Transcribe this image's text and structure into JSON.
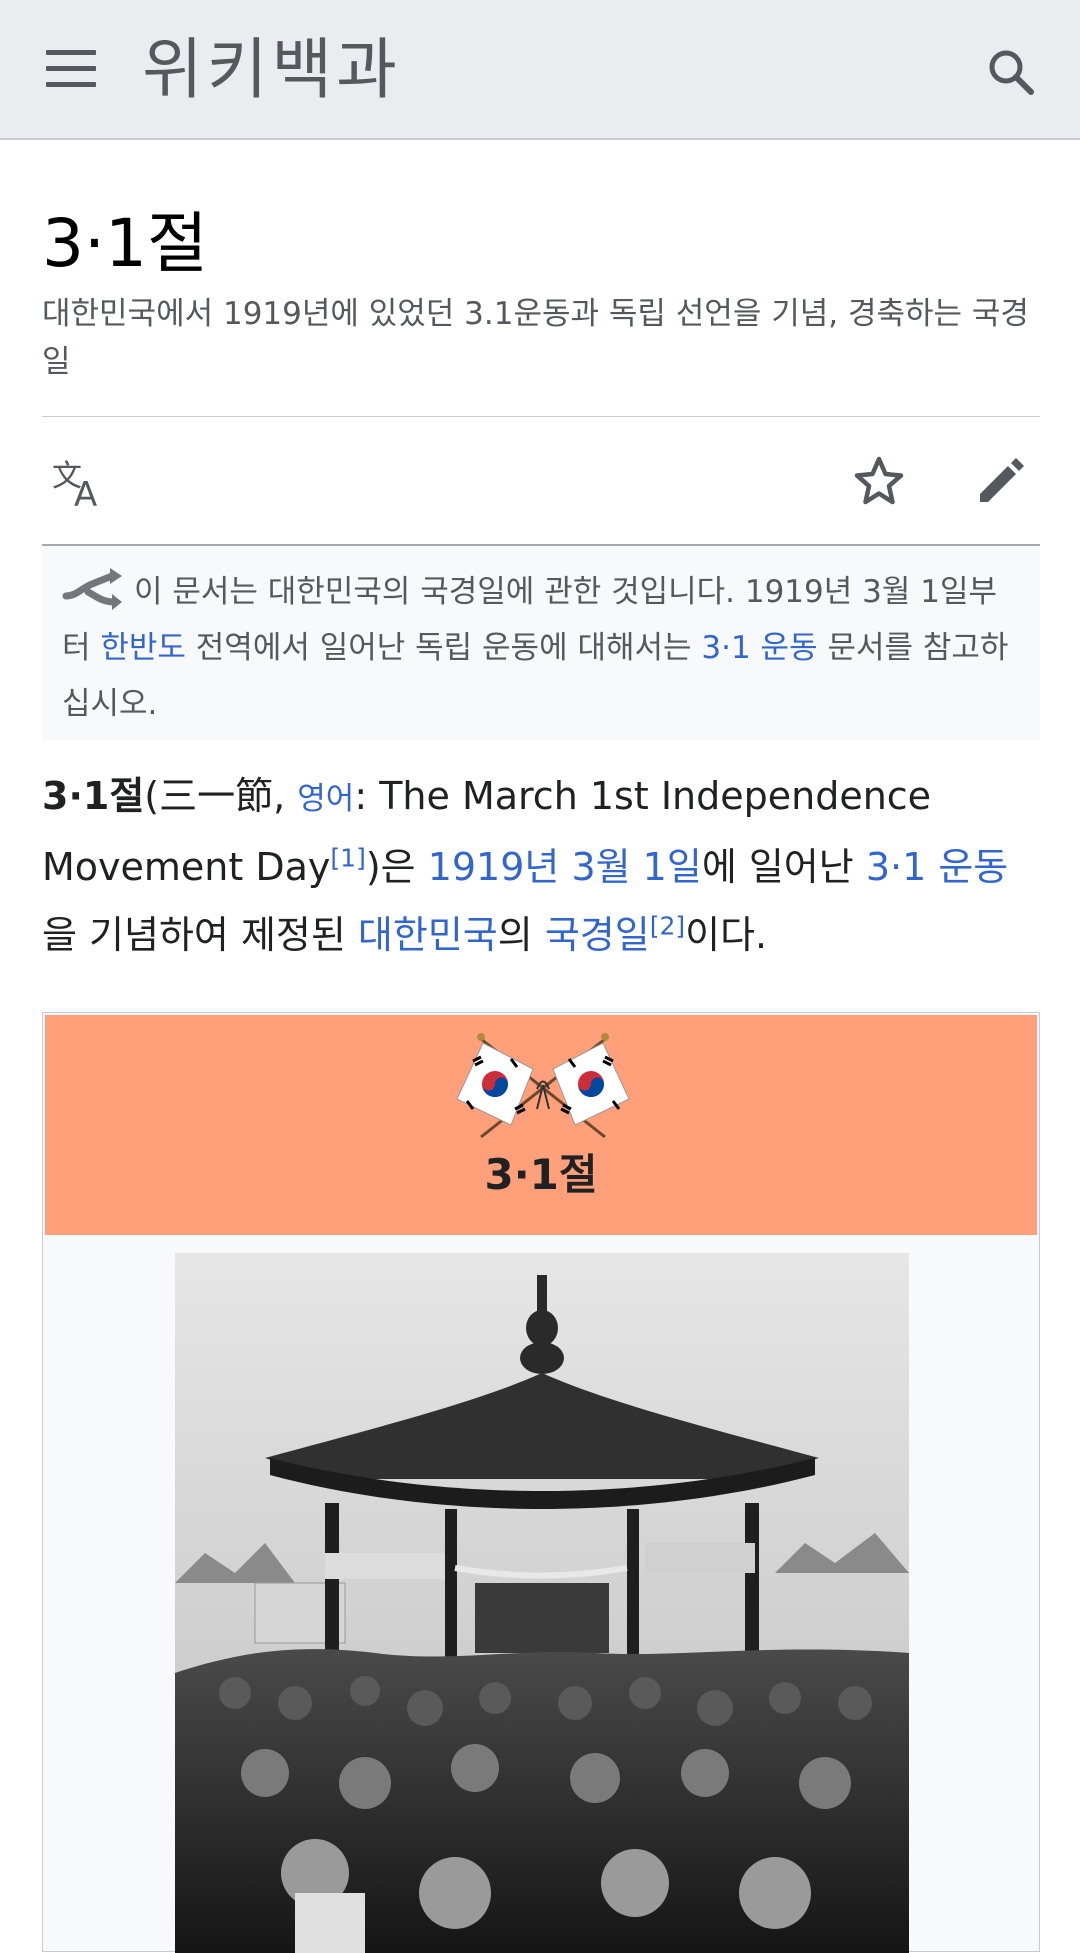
{
  "header": {
    "wordmark": "위키백과",
    "menu_icon": "hamburger-menu-icon",
    "search_icon": "search-icon"
  },
  "page": {
    "title": "3·1절",
    "description": "대한민국에서 1919년에 있었던 3.1운동과 독립 선언을 기념, 경축하는 국경일"
  },
  "actions": {
    "language_icon": "language-icon",
    "watch_icon": "star-icon",
    "edit_icon": "pencil-icon"
  },
  "hatnote": {
    "text_1": "이 문서는 대한민국의 국경일에 관한 것입니다. 1919년 3월 1일부터 ",
    "link_1": "한반도",
    "text_2": " 전역에서 일어난 독립 운동에 대해서는 ",
    "link_2": "3·1 운동",
    "text_3": " 문서를 참고하십시오."
  },
  "lead": {
    "bold_title": "3·1절",
    "paren_open": "(三一節, ",
    "lang_link": "영어",
    "english": ": The March 1st Independence Movement Day",
    "ref_1": "[1]",
    "text_a": ")은 ",
    "date_link": "1919년 3월 1일",
    "text_b": "에 일어난 ",
    "movement_link": "3·1 운동",
    "text_c": "을 기념하여 제정된 ",
    "country_link": "대한민국",
    "text_d": "의 ",
    "holiday_link": "국경일",
    "ref_2": "[2]",
    "text_e": "이다."
  },
  "infobox": {
    "title": "3·1절",
    "header_color": "#ffa07a",
    "emblem": "crossed-korean-flags",
    "photo": "pavilion-crowd-photo"
  },
  "colors": {
    "link": "#3366cc",
    "header_bg": "#eaecf0",
    "muted_text": "#54595d"
  }
}
